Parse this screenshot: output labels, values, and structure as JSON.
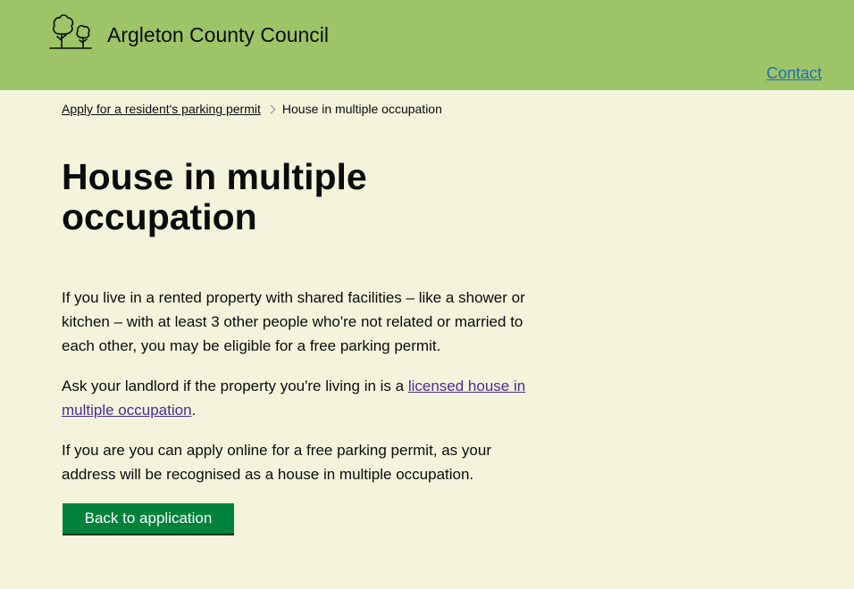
{
  "header": {
    "org_name": "Argleton County Council",
    "logo_icon": "trees-logo-icon",
    "nav_contact": "Contact"
  },
  "breadcrumb": {
    "parent_link": "Apply for a resident's parking permit",
    "separator_icon": "chevron-right-icon",
    "current": "House in multiple occupation"
  },
  "main": {
    "title": "House in multiple occupation",
    "paragraph_1": "If you live in a rented property with shared facilities – like a shower or kitchen – with at least 3 other people who're not related or married to each other, you may be eligible for a free parking permit.",
    "paragraph_2_before_link": "Ask your landlord if the property you're living in is a ",
    "paragraph_2_link": "licensed house in multiple occupation",
    "paragraph_2_after_link": ".",
    "paragraph_3": "If you are you can apply online for a free parking permit, as your address will be recognised as a house in multiple occupation.",
    "back_button": "Back to application"
  },
  "colors": {
    "header_bg": "#9dc467",
    "page_bg": "#f4f4dc",
    "link": "#1d70b8",
    "visited_link": "#4c2c92",
    "button_bg": "#00823b"
  }
}
